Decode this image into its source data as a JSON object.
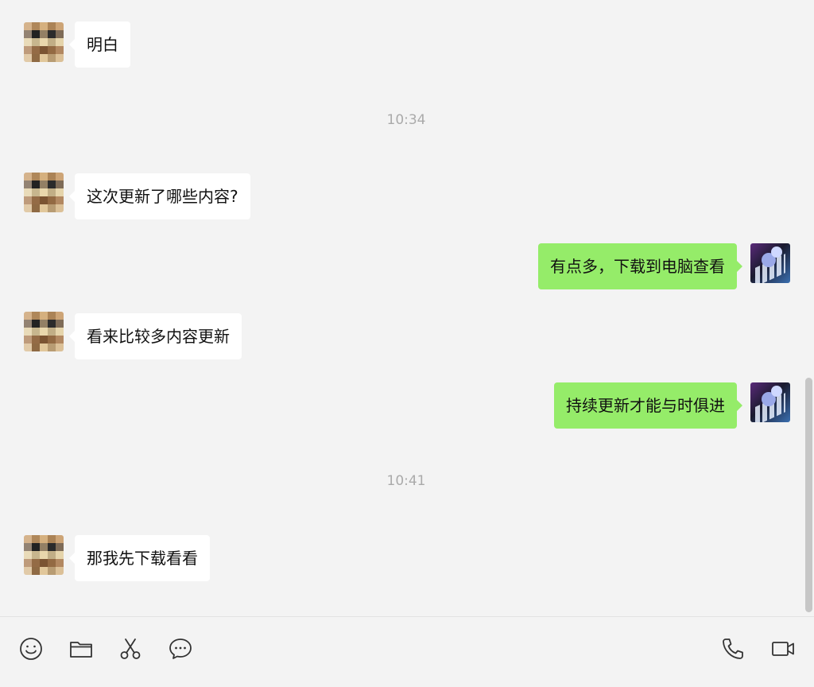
{
  "messages": [
    {
      "side": "left",
      "text": "明白"
    },
    {
      "side": "left",
      "text": "这次更新了哪些内容?"
    },
    {
      "side": "right",
      "text": "有点多，下载到电脑查看"
    },
    {
      "side": "left",
      "text": "看来比较多内容更新"
    },
    {
      "side": "right",
      "text": "持续更新才能与时俱进"
    },
    {
      "side": "left",
      "text": "那我先下载看看"
    }
  ],
  "timestamps": [
    "10:34",
    "10:41"
  ],
  "toolbar": {
    "left_icons": [
      "emoji-icon",
      "folder-icon",
      "scissors-icon",
      "chat-bubble-icon"
    ],
    "right_icons": [
      "phone-icon",
      "video-camera-icon"
    ]
  },
  "colors": {
    "background": "#f3f3f3",
    "incoming_bubble": "#ffffff",
    "outgoing_bubble": "#95ec69",
    "timestamp_text": "#aaaaaa"
  }
}
